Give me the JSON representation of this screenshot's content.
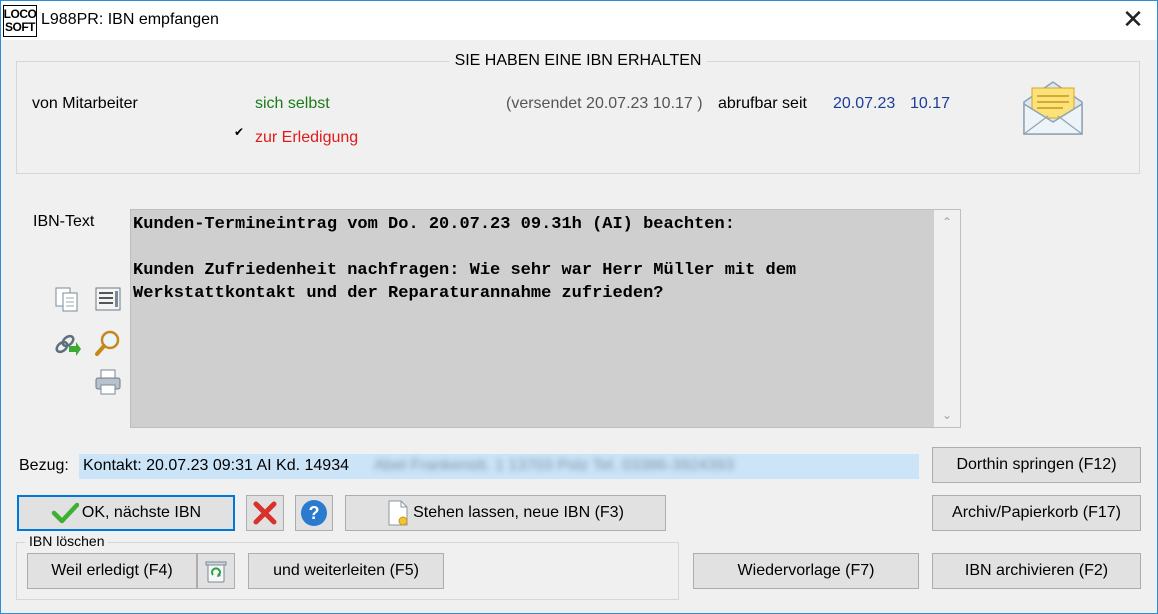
{
  "window": {
    "logo_line1": "LOCO",
    "logo_line2": "SOFT",
    "title": "L988PR: IBN empfangen",
    "close_glyph": "✕"
  },
  "header": {
    "group_title": "SIE HABEN EINE IBN ERHALTEN",
    "from_label": "von Mitarbeiter",
    "from_value": "sich selbst",
    "check_glyph": "✔",
    "purpose": "zur Erledigung",
    "sent_label": "(versendet 20.07.23  10.17 )",
    "available_label": "abrufbar seit",
    "available_date": "20.07.23",
    "available_time": "10.17",
    "envelope_icon": "open-envelope-icon"
  },
  "ibn_text": {
    "label": "IBN-Text",
    "content": "Kunden-Termineintrag vom Do. 20.07.23 09.31h (AI) beachten:\n\nKunden Zufriedenheit nachfragen: Wie sehr war Herr Müller mit dem\nWerkstattkontakt und der Reparaturannahme zufrieden?",
    "scroll_up": "⌃",
    "scroll_down": "⌄"
  },
  "side_icons": [
    "copy-icon",
    "list-icon",
    "link-arrow-icon",
    "magnifier-icon",
    "printer-icon"
  ],
  "reference": {
    "label": "Bezug:",
    "value": "Kontakt: 20.07.23 09:31 AI Kd. 14934",
    "blurred": "Abel Frankenstt. 1 13703 Polz Tel. 03386-3924393"
  },
  "buttons": {
    "ok_next": "OK, nächste IBN",
    "stehen_lassen": "Stehen lassen, neue IBN (F3)",
    "dorthin": "Dorthin springen (F12)",
    "archiv_papierkorb": "Archiv/Papierkorb (F17)",
    "weil_erledigt": "Weil erledigt (F4)",
    "weiterleiten": "und weiterleiten (F5)",
    "wiedervorlage": "Wiedervorlage (F7)",
    "archivieren": "IBN archivieren (F2)",
    "help_glyph": "?"
  },
  "delete_group": {
    "caption": "IBN löschen"
  },
  "colors": {
    "accent": "#0078d7",
    "green": "#1a7a1a",
    "red": "#e01b1b",
    "blue": "#1c3d9a",
    "text_bg": "#cfcfcf",
    "ref_bg": "#cce4f7"
  }
}
